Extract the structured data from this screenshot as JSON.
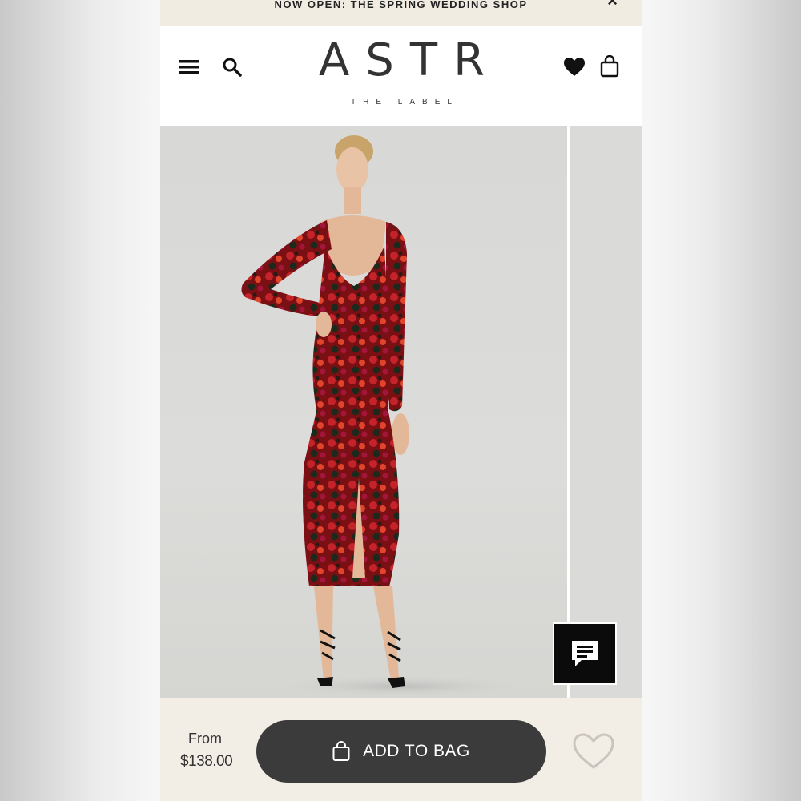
{
  "announcement": {
    "text": "NOW OPEN: THE SPRING WEDDING SHOP",
    "close_glyph": "×"
  },
  "header": {
    "logo_main": "ASTR",
    "logo_sub": "THE LABEL",
    "icons": [
      "menu-icon",
      "search-icon",
      "heart-icon",
      "bag-icon"
    ]
  },
  "gallery": {
    "chat_icon": "chat-icon"
  },
  "purchase": {
    "from_label": "From",
    "price": "$138.00",
    "add_label": "ADD TO BAG",
    "wishlist_icon": "heart-outline-icon"
  },
  "colors": {
    "announcement_bg": "#f1ece2",
    "button_bg": "#3b3b3b",
    "bottom_bar_bg": "#f2ede5",
    "photo_bg": "#dcdcda"
  }
}
